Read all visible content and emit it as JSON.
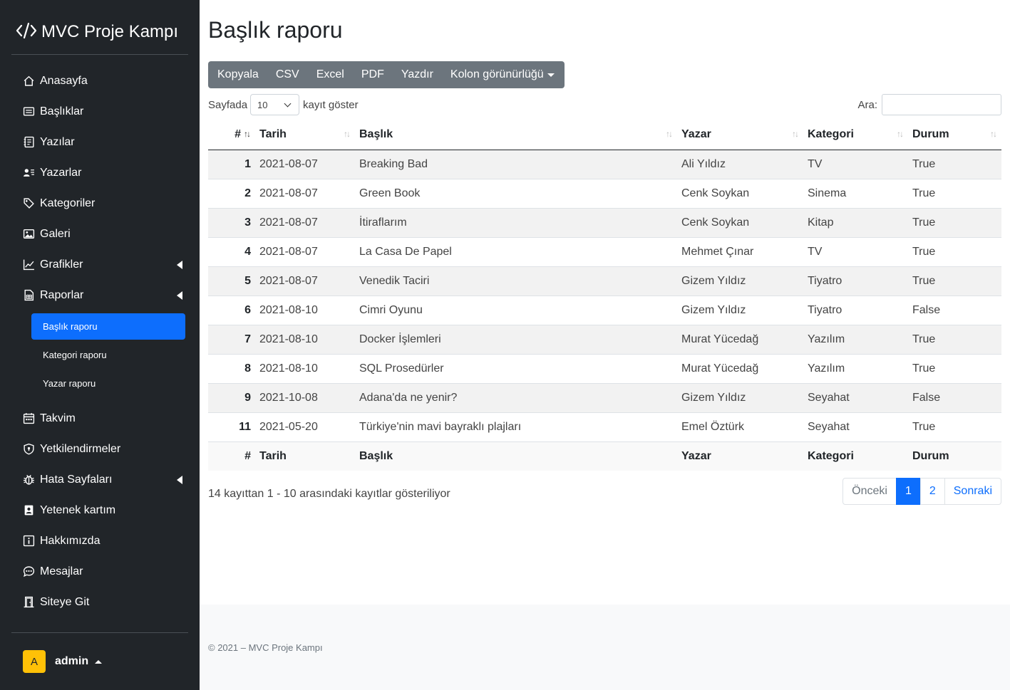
{
  "sidebar": {
    "brand": "MVC Proje Kampı",
    "items": [
      {
        "label": "Anasayfa",
        "icon": "house-icon"
      },
      {
        "label": "Başlıklar",
        "icon": "card-list-icon"
      },
      {
        "label": "Yazılar",
        "icon": "journal-text-icon"
      },
      {
        "label": "Yazarlar",
        "icon": "person-lines-icon"
      },
      {
        "label": "Kategoriler",
        "icon": "tags-icon"
      },
      {
        "label": "Galeri",
        "icon": "images-icon"
      },
      {
        "label": "Grafikler",
        "icon": "graph-up-icon"
      },
      {
        "label": "Raporlar",
        "icon": "file-spreadsheet-icon"
      }
    ],
    "sub_items": [
      {
        "label": "Başlık raporu",
        "active": true
      },
      {
        "label": "Kategori raporu",
        "active": false
      },
      {
        "label": "Yazar raporu",
        "active": false
      }
    ],
    "items_after": [
      {
        "label": "Takvim",
        "icon": "calendar-icon"
      },
      {
        "label": "Yetkilendirmeler",
        "icon": "shield-icon"
      },
      {
        "label": "Hata Sayfaları",
        "icon": "bug-icon"
      },
      {
        "label": "Yetenek kartım",
        "icon": "person-badge-icon"
      },
      {
        "label": "Hakkımızda",
        "icon": "info-square-icon"
      },
      {
        "label": "Mesajlar",
        "icon": "chat-dots-icon"
      },
      {
        "label": "Siteye Git",
        "icon": "door-icon"
      }
    ],
    "user": {
      "initial": "A",
      "name": "admin"
    }
  },
  "main": {
    "title": "Başlık raporu",
    "buttons": [
      "Kopyala",
      "CSV",
      "Excel",
      "PDF",
      "Yazdır",
      "Kolon görünürlüğü"
    ],
    "length": {
      "prefix": "Sayfada",
      "value": "10",
      "suffix": "kayıt göster"
    },
    "search_label": "Ara:",
    "columns": [
      "#",
      "Tarih",
      "Başlık",
      "Yazar",
      "Kategori",
      "Durum"
    ],
    "rows": [
      [
        "1",
        "2021-08-07",
        "Breaking Bad",
        "Ali Yıldız",
        "TV",
        "True"
      ],
      [
        "2",
        "2021-08-07",
        "Green Book",
        "Cenk Soykan",
        "Sinema",
        "True"
      ],
      [
        "3",
        "2021-08-07",
        "İtiraflarım",
        "Cenk Soykan",
        "Kitap",
        "True"
      ],
      [
        "4",
        "2021-08-07",
        "La Casa De Papel",
        "Mehmet Çınar",
        "TV",
        "True"
      ],
      [
        "5",
        "2021-08-07",
        "Venedik Taciri",
        "Gizem Yıldız",
        "Tiyatro",
        "True"
      ],
      [
        "6",
        "2021-08-10",
        "Cimri Oyunu",
        "Gizem Yıldız",
        "Tiyatro",
        "False"
      ],
      [
        "7",
        "2021-08-10",
        "Docker İşlemleri",
        "Murat Yücedağ",
        "Yazılım",
        "True"
      ],
      [
        "8",
        "2021-08-10",
        "SQL Prosedürler",
        "Murat Yücedağ",
        "Yazılım",
        "True"
      ],
      [
        "9",
        "2021-10-08",
        "Adana'da ne yenir?",
        "Gizem Yıldız",
        "Seyahat",
        "False"
      ],
      [
        "11",
        "2021-05-20",
        "Türkiye'nin mavi bayraklı plajları",
        "Emel Öztürk",
        "Seyahat",
        "True"
      ]
    ],
    "info": "14 kayıttan 1 - 10 arasındaki kayıtlar gösteriliyor",
    "pagination": {
      "prev": "Önceki",
      "pages": [
        "1",
        "2"
      ],
      "current": "1",
      "next": "Sonraki"
    }
  },
  "footer": {
    "text": "© 2021 – MVC Proje Kampı"
  }
}
